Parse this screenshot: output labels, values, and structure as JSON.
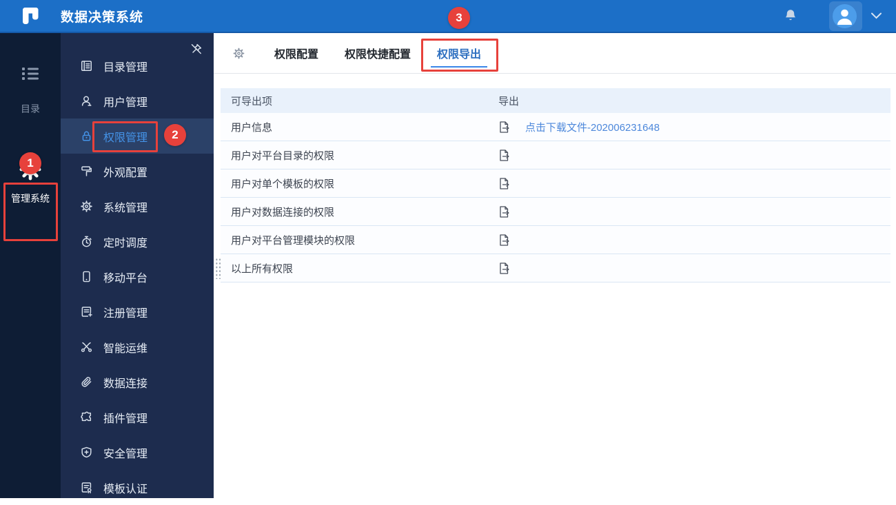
{
  "topbar": {
    "title": "数据决策系统"
  },
  "primary_sidebar": {
    "items": [
      {
        "label": "目录",
        "icon": "directory-list-icon",
        "active": false
      },
      {
        "label": "管理系统",
        "icon": "gear-icon",
        "active": true
      }
    ]
  },
  "secondary_sidebar": {
    "pin_icon": "unpin-icon",
    "items": [
      {
        "label": "目录管理",
        "icon": "catalog-icon"
      },
      {
        "label": "用户管理",
        "icon": "user-icon"
      },
      {
        "label": "权限管理",
        "icon": "lock-icon",
        "active": true
      },
      {
        "label": "外观配置",
        "icon": "paint-roller-icon"
      },
      {
        "label": "系统管理",
        "icon": "gear-outline-icon"
      },
      {
        "label": "定时调度",
        "icon": "timer-icon"
      },
      {
        "label": "移动平台",
        "icon": "mobile-icon"
      },
      {
        "label": "注册管理",
        "icon": "register-doc-icon"
      },
      {
        "label": "智能运维",
        "icon": "ops-network-icon"
      },
      {
        "label": "数据连接",
        "icon": "paperclip-icon"
      },
      {
        "label": "插件管理",
        "icon": "puzzle-icon"
      },
      {
        "label": "安全管理",
        "icon": "shield-plus-icon"
      },
      {
        "label": "模板认证",
        "icon": "template-seal-icon"
      }
    ]
  },
  "tabbar": {
    "tabs": [
      {
        "label": "权限配置",
        "active": false
      },
      {
        "label": "权限快捷配置",
        "active": false
      },
      {
        "label": "权限导出",
        "active": true
      }
    ]
  },
  "annotations": {
    "step1": "1",
    "step2": "2",
    "step3": "3",
    "color": "#E7413B"
  },
  "table": {
    "headers": {
      "item": "可导出项",
      "export": "导出"
    },
    "rows": [
      {
        "item": "用户信息",
        "link": "点击下载文件-202006231648"
      },
      {
        "item": "用户对平台目录的权限"
      },
      {
        "item": "用户对单个模板的权限"
      },
      {
        "item": "用户对数据连接的权限"
      },
      {
        "item": "用户对平台管理模块的权限"
      },
      {
        "item": "以上所有权限"
      }
    ]
  },
  "colors": {
    "topbar_blue": "#1C6FC7",
    "primary_sidebar": "#0E1D35",
    "secondary_sidebar": "#1D2C4E",
    "active_item_bg": "#2B4168",
    "accent_blue": "#4493E8",
    "active_tab_blue": "#2D6FC0",
    "link_blue": "#4D88DB",
    "table_header_bg": "#E9F1FB",
    "annotation_red": "#E7413B"
  }
}
